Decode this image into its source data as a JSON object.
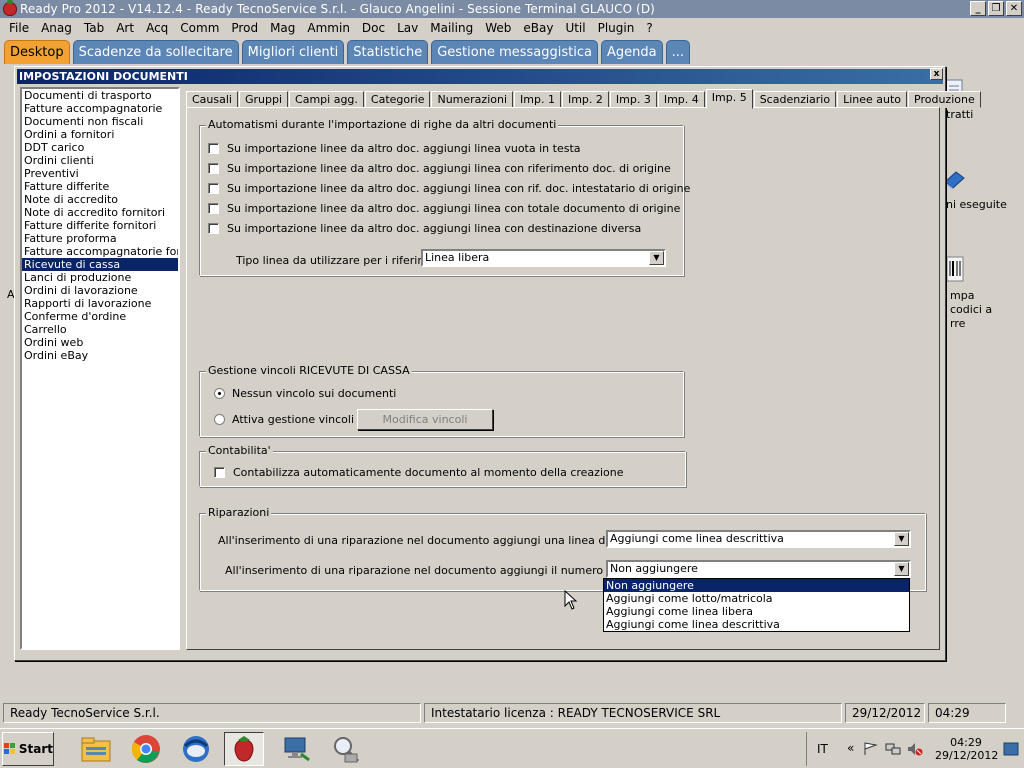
{
  "window": {
    "title": "Ready Pro 2012 - V14.12.4 - Ready TecnoService S.r.l. - Glauco Angelini - Sessione Terminal GLAUCO (D)",
    "min_glyph": "_",
    "max_glyph": "❐",
    "close_glyph": "✕"
  },
  "menu": [
    "File",
    "Anag",
    "Tab",
    "Art",
    "Acq",
    "Comm",
    "Prod",
    "Mag",
    "Ammin",
    "Doc",
    "Lav",
    "Mailing",
    "Web",
    "eBay",
    "Util",
    "Plugin",
    "?"
  ],
  "top_tabs": [
    {
      "label": "Desktop",
      "active": true
    },
    {
      "label": "Scadenze da sollecitare",
      "active": false
    },
    {
      "label": "Migliori clienti",
      "active": false
    },
    {
      "label": "Statistiche",
      "active": false
    },
    {
      "label": "Gestione messaggistica",
      "active": false
    },
    {
      "label": "Agenda",
      "active": false
    },
    {
      "label": "...",
      "active": false
    }
  ],
  "desktop_labels": {
    "l1": "tratti",
    "l2": "ni eseguite",
    "l3": "mpa",
    "l4": "codici a",
    "l5": "rre",
    "left_fragment": "A"
  },
  "dialog": {
    "title": "IMPOSTAZIONI DOCUMENTI",
    "close_glyph": "x",
    "doc_types": [
      "Documenti di trasporto",
      "Fatture accompagnatorie",
      "Documenti non fiscali",
      "Ordini a fornitori",
      "DDT carico",
      "Ordini clienti",
      "Preventivi",
      "Fatture differite",
      "Note di accredito",
      "Note di accredito fornitori",
      "Fatture differite fornitori",
      "Fatture proforma",
      "Fatture accompagnatorie fornitori",
      "Ricevute di cassa",
      "Lanci di produzione",
      "Ordini di lavorazione",
      "Rapporti di lavorazione",
      "Conferme d'ordine",
      "Carrello",
      "Ordini web",
      "Ordini eBay"
    ],
    "selected_doc_index": 13,
    "tabs": [
      "Causali",
      "Gruppi",
      "Campi agg.",
      "Categorie",
      "Numerazioni",
      "Imp. 1",
      "Imp. 2",
      "Imp. 3",
      "Imp. 4",
      "Imp. 5",
      "Scadenziario",
      "Linee auto",
      "Produzione"
    ],
    "active_tab_index": 9,
    "automatismi": {
      "title": "Automatismi durante l'importazione di righe da altri documenti",
      "checks": [
        {
          "label": "Su importazione linee da altro doc. aggiungi linea vuota in testa",
          "checked": false
        },
        {
          "label": "Su importazione linee da altro doc. aggiungi linea con riferimento doc. di origine",
          "checked": false
        },
        {
          "label": "Su importazione linee da altro doc. aggiungi linea con rif. doc. intestatario di origine",
          "checked": false
        },
        {
          "label": "Su importazione linee da altro doc. aggiungi linea con totale documento di origine",
          "checked": false
        },
        {
          "label": "Su importazione linee da altro doc. aggiungi linea con destinazione diversa",
          "checked": false
        }
      ],
      "tipo_linea_label": "Tipo linea da utilizzare per i riferimenti :",
      "tipo_linea_value": "Linea libera"
    },
    "vincoli": {
      "title": "Gestione vincoli RICEVUTE DI CASSA",
      "radio_1": "Nessun vincolo sui documenti",
      "radio_2": "Attiva gestione vincoli",
      "selected": 1,
      "modifica_button": "Modifica vincoli"
    },
    "contabilita": {
      "title": "Contabilita'",
      "check_label": "Contabilizza automaticamente documento al momento della creazione",
      "checked": false
    },
    "riparazioni": {
      "title": "Riparazioni",
      "row1_label": "All'inserimento di una riparazione nel documento aggiungi una linea di riferimento :",
      "row1_value": "Aggiungi come linea descrittiva",
      "row2_label": "All'inserimento di una riparazione nel documento aggiungi il numero di matricola :",
      "row2_value": "Non aggiungere",
      "options": [
        "Non aggiungere",
        "Aggiungi come lotto/matricola",
        "Aggiungi come linea libera",
        "Aggiungi come linea descrittiva"
      ],
      "highlighted_option_index": 0
    },
    "combo_arrow": "▼"
  },
  "statusbar": {
    "company": "Ready TecnoService S.r.l.",
    "license": "Intestatario licenza : READY TECNOSERVICE SRL",
    "date": "29/12/2012",
    "time": "04:29"
  },
  "taskbar": {
    "start_label": "Start",
    "lang": "IT",
    "tray_chevron": "«",
    "clock_time": "04:29",
    "clock_date": "29/12/2012"
  },
  "colors": {
    "title_bar": "#7a8ba3",
    "tab_blue": "#5b86b6",
    "tab_active_orange": "#f2a233",
    "selection_blue": "#0a246a"
  }
}
